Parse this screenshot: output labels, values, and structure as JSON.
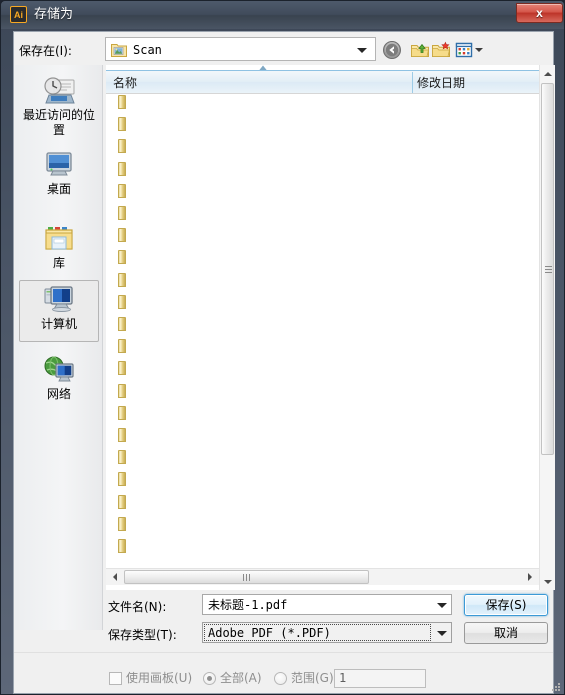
{
  "window": {
    "title": "存储为",
    "app_icon": "Ai",
    "close_label": "x",
    "title_icon_name": "illustrator-app-icon"
  },
  "toolbar": {
    "save_in_label": "保存在(I):",
    "current_folder": "Scan",
    "buttons": [
      {
        "name": "back-button",
        "icon": "back-arrow-icon"
      },
      {
        "name": "up-one-level-button",
        "icon": "folder-up-icon"
      },
      {
        "name": "new-folder-button",
        "icon": "new-folder-icon"
      },
      {
        "name": "views-button",
        "icon": "views-grid-icon"
      }
    ]
  },
  "places": {
    "items": [
      {
        "label": "最近访问的位置",
        "icon": "recent-places-icon",
        "selected": false
      },
      {
        "label": "桌面",
        "icon": "desktop-icon",
        "selected": false
      },
      {
        "label": "库",
        "icon": "libraries-icon",
        "selected": false
      },
      {
        "label": "计算机",
        "icon": "computer-icon",
        "selected": true
      },
      {
        "label": "网络",
        "icon": "network-icon",
        "selected": false
      }
    ]
  },
  "filelist": {
    "columns": [
      {
        "label": "名称",
        "sorted": "ascending"
      },
      {
        "label": "修改日期",
        "sorted": ""
      }
    ],
    "row_count": 22,
    "rows": []
  },
  "form": {
    "filename_label": "文件名(N):",
    "filename_value": "未标题-1.pdf",
    "filetype_label": "保存类型(T):",
    "filetype_value": "Adobe PDF (*.PDF)",
    "save_button": "保存(S)",
    "cancel_button": "取消"
  },
  "options": {
    "use_artboards_label": "使用画板(U)",
    "use_artboards_checked": false,
    "all_label": "全部(A)",
    "all_selected": true,
    "range_label": "范围(G)",
    "range_selected": false,
    "range_value": "1"
  },
  "colors": {
    "accent": "#3c9ad6",
    "titlebar": "#49546",
    "close_red": "#bd3328",
    "header_blue": "#8fc2e3",
    "folder_gold": "#e3cd7f"
  }
}
